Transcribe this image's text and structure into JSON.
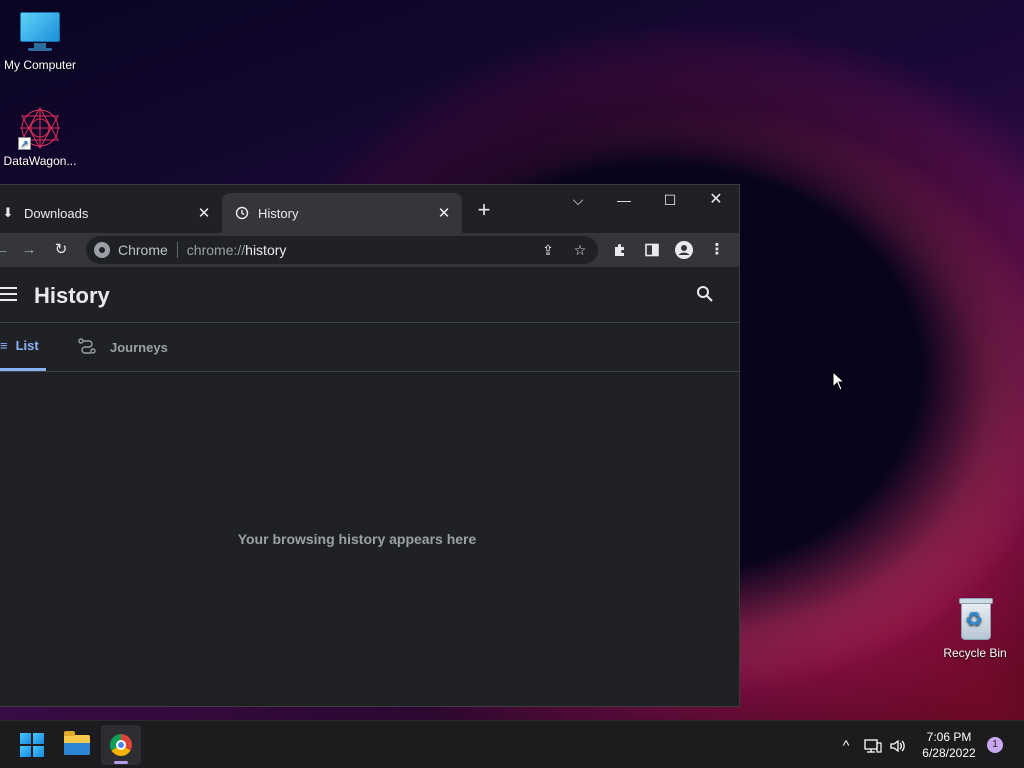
{
  "desktop": {
    "icons": [
      {
        "label": "My Computer"
      },
      {
        "label": "DataWagon..."
      },
      {
        "label": "Recycle Bin"
      }
    ]
  },
  "browser": {
    "tabs": [
      {
        "label": "Downloads",
        "icon": "download-icon"
      },
      {
        "label": "History",
        "icon": "history-icon",
        "active": true
      }
    ],
    "omnibox": {
      "chip": "Chrome",
      "url_scheme": "chrome://",
      "url_path": "history"
    },
    "page": {
      "title": "History",
      "nav_tabs": [
        {
          "label": "List",
          "active": true
        },
        {
          "label": "Journeys"
        }
      ],
      "empty_message": "Your browsing history appears here"
    }
  },
  "taskbar": {
    "clock_time": "7:06 PM",
    "clock_date": "6/28/2022",
    "notification_count": "1"
  },
  "colors": {
    "accent": "#8ab4f8",
    "window_bg": "#202124",
    "toolbar_bg": "#35363a"
  }
}
